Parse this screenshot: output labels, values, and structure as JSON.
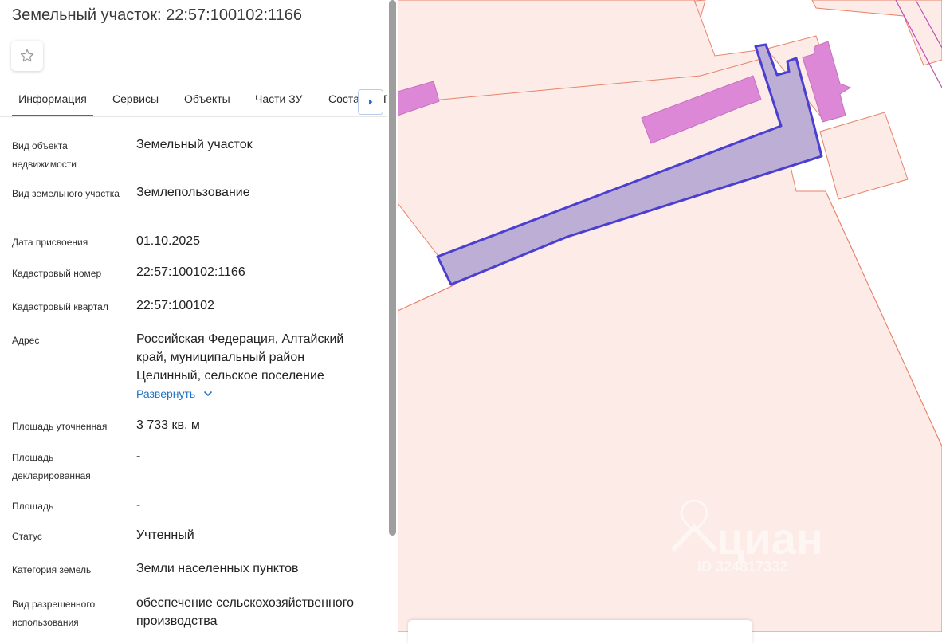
{
  "header": {
    "title": "Земельный участок: 22:57:100102:1166"
  },
  "favorite": {
    "icon": "star-outline-icon"
  },
  "tabs": [
    {
      "label": "Информация",
      "active": true
    },
    {
      "label": "Сервисы",
      "active": false
    },
    {
      "label": "Объекты",
      "active": false
    },
    {
      "label": "Части ЗУ",
      "active": false
    },
    {
      "label": "Соста",
      "active": false
    },
    {
      "label": "Г",
      "active": false
    }
  ],
  "rows": [
    {
      "label": "Вид объекта недвижимости",
      "value": "Земельный участок"
    },
    {
      "label": "Вид земельного участка",
      "value": "Землепользование"
    },
    {
      "label": "Дата присвоения",
      "value": "01.10.2025"
    },
    {
      "label": "Кадастровый номер",
      "value": "22:57:100102:1166"
    },
    {
      "label": "Кадастровый квартал",
      "value": "22:57:100102"
    },
    {
      "label": "Адрес",
      "value": "Российская Федерация, Алтайский край, муниципальный район Целинный, сельское поселение"
    },
    {
      "label": "Площадь уточненная",
      "value": "3 733 кв. м"
    },
    {
      "label": "Площадь декларированная",
      "value": "-"
    },
    {
      "label": "Площадь",
      "value": "-"
    },
    {
      "label": "Статус",
      "value": "Учтенный"
    },
    {
      "label": "Категория земель",
      "value": "Земли населенных пунктов"
    },
    {
      "label": "Вид разрешенного использования",
      "value": "обеспечение сельскохозяйственного производства"
    }
  ],
  "address_expand_label": "Развернуть",
  "watermark": {
    "brand": "циан",
    "code": "ID 324817332"
  },
  "colors": {
    "map_bg": "#fcebe6",
    "parcel_border": "#e8836a",
    "building_fill": "#dd88d6",
    "selected_fill": "#bdaed6",
    "selected_border": "#4a3fd1",
    "accent": "#2a6ed6"
  }
}
